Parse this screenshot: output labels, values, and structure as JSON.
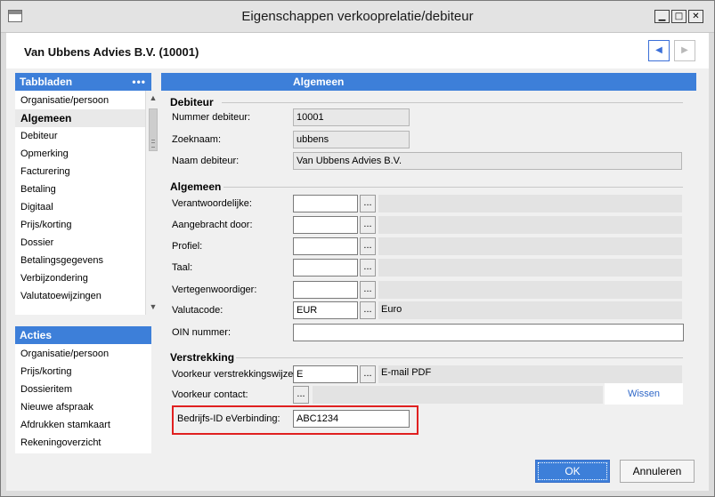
{
  "window": {
    "title": "Eigenschappen verkooprelatie/debiteur",
    "min_symbol": "▁",
    "max_symbol": "□",
    "close_symbol": "✕"
  },
  "header": {
    "company": "Van Ubbens Advies B.V. (10001)",
    "prev_symbol": "◀",
    "next_symbol": "▶"
  },
  "tabs_panel": {
    "title": "Tabbladen",
    "more": "•••",
    "items": [
      {
        "label": "Organisatie/persoon"
      },
      {
        "label": "Algemeen"
      },
      {
        "label": "Debiteur"
      },
      {
        "label": "Opmerking"
      },
      {
        "label": "Facturering"
      },
      {
        "label": "Betaling"
      },
      {
        "label": "Digitaal"
      },
      {
        "label": "Prijs/korting"
      },
      {
        "label": "Dossier"
      },
      {
        "label": "Betalingsgegevens"
      },
      {
        "label": "Verbijzondering"
      },
      {
        "label": "Valutatoewijzingen"
      }
    ],
    "active_index": 1,
    "scroll_up": "▲",
    "scroll_down": "▼"
  },
  "actions_panel": {
    "title": "Acties",
    "items": [
      {
        "label": "Organisatie/persoon"
      },
      {
        "label": "Prijs/korting"
      },
      {
        "label": "Dossieritem"
      },
      {
        "label": "Nieuwe afspraak"
      },
      {
        "label": "Afdrukken stamkaart"
      },
      {
        "label": "Rekeningoverzicht"
      }
    ]
  },
  "main": {
    "title": "Algemeen",
    "debiteur": {
      "section": "Debiteur",
      "nummer_label": "Nummer debiteur:",
      "nummer_value": "10001",
      "zoeknaam_label": "Zoeknaam:",
      "zoeknaam_value": "ubbens",
      "naam_label": "Naam debiteur:",
      "naam_value": "Van Ubbens Advies B.V."
    },
    "algemeen": {
      "section": "Algemeen",
      "verantwoordelijke_label": "Verantwoordelijke:",
      "verantwoordelijke_value": "",
      "aangebracht_label": "Aangebracht door:",
      "aangebracht_value": "",
      "profiel_label": "Profiel:",
      "profiel_value": "",
      "taal_label": "Taal:",
      "taal_value": "",
      "vertegenwoordiger_label": "Vertegenwoordiger:",
      "vertegenwoordiger_value": "",
      "valutacode_label": "Valutacode:",
      "valutacode_value": "EUR",
      "valutacode_desc": "Euro",
      "oin_label": "OIN nummer:",
      "oin_value": ""
    },
    "verstrekking": {
      "section": "Verstrekking",
      "voorkeur_wijze_label": "Voorkeur verstrekkingswijze:",
      "voorkeur_wijze_value": "E",
      "voorkeur_wijze_desc": "E-mail PDF",
      "voorkeur_contact_label": "Voorkeur contact:",
      "wissen_label": "Wissen",
      "bedrijfs_id_label": "Bedrijfs-ID eVerbinding:",
      "bedrijfs_id_value": "ABC1234"
    },
    "ellipsis": "..."
  },
  "footer": {
    "ok_label": "OK",
    "cancel_label": "Annuleren"
  },
  "colors": {
    "accent": "#3d7fd9",
    "highlight": "#e02020"
  }
}
